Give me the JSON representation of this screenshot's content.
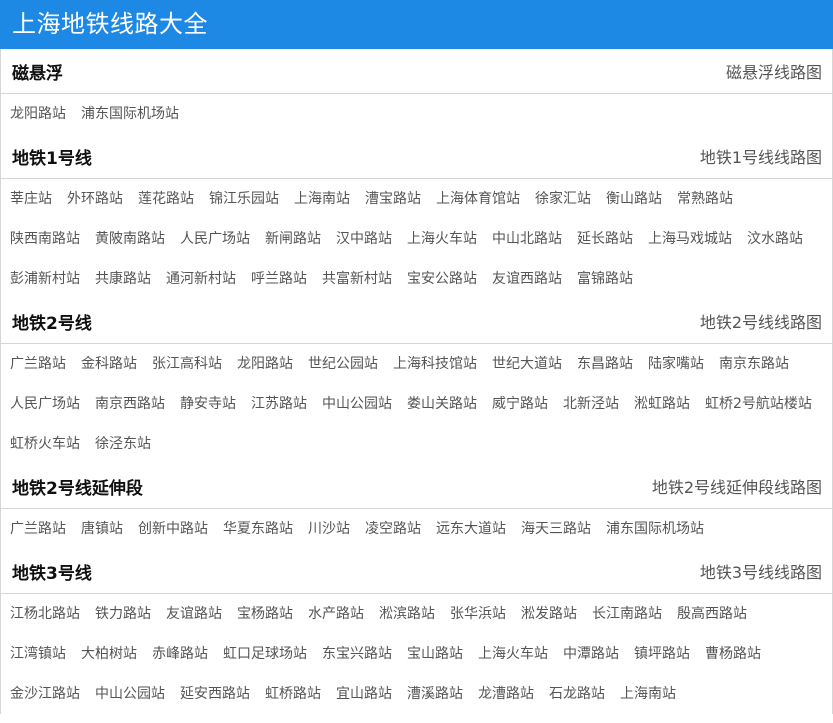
{
  "page": {
    "title": "上海地铁线路大全"
  },
  "lines": [
    {
      "name": "磁悬浮",
      "map_link": "磁悬浮线路图",
      "stations": [
        "龙阳路站",
        "浦东国际机场站"
      ]
    },
    {
      "name": "地铁1号线",
      "map_link": "地铁1号线线路图",
      "stations": [
        "莘庄站",
        "外环路站",
        "莲花路站",
        "锦江乐园站",
        "上海南站",
        "漕宝路站",
        "上海体育馆站",
        "徐家汇站",
        "衡山路站",
        "常熟路站",
        "陕西南路站",
        "黄陂南路站",
        "人民广场站",
        "新闸路站",
        "汉中路站",
        "上海火车站",
        "中山北路站",
        "延长路站",
        "上海马戏城站",
        "汶水路站",
        "彭浦新村站",
        "共康路站",
        "通河新村站",
        "呼兰路站",
        "共富新村站",
        "宝安公路站",
        "友谊西路站",
        "富锦路站"
      ]
    },
    {
      "name": "地铁2号线",
      "map_link": "地铁2号线线路图",
      "stations": [
        "广兰路站",
        "金科路站",
        "张江高科站",
        "龙阳路站",
        "世纪公园站",
        "上海科技馆站",
        "世纪大道站",
        "东昌路站",
        "陆家嘴站",
        "南京东路站",
        "人民广场站",
        "南京西路站",
        "静安寺站",
        "江苏路站",
        "中山公园站",
        "娄山关路站",
        "威宁路站",
        "北新泾站",
        "淞虹路站",
        "虹桥2号航站楼站",
        "虹桥火车站",
        "徐泾东站"
      ]
    },
    {
      "name": "地铁2号线延伸段",
      "map_link": "地铁2号线延伸段线路图",
      "stations": [
        "广兰路站",
        "唐镇站",
        "创新中路站",
        "华夏东路站",
        "川沙站",
        "凌空路站",
        "远东大道站",
        "海天三路站",
        "浦东国际机场站"
      ]
    },
    {
      "name": "地铁3号线",
      "map_link": "地铁3号线线路图",
      "stations": [
        "江杨北路站",
        "铁力路站",
        "友谊路站",
        "宝杨路站",
        "水产路站",
        "淞滨路站",
        "张华浜站",
        "淞发路站",
        "长江南路站",
        "殷高西路站",
        "江湾镇站",
        "大柏树站",
        "赤峰路站",
        "虹口足球场站",
        "东宝兴路站",
        "宝山路站",
        "上海火车站",
        "中潭路站",
        "镇坪路站",
        "曹杨路站",
        "金沙江路站",
        "中山公园站",
        "延安西路站",
        "虹桥路站",
        "宜山路站",
        "漕溪路站",
        "龙漕路站",
        "石龙路站",
        "上海南站"
      ]
    }
  ]
}
